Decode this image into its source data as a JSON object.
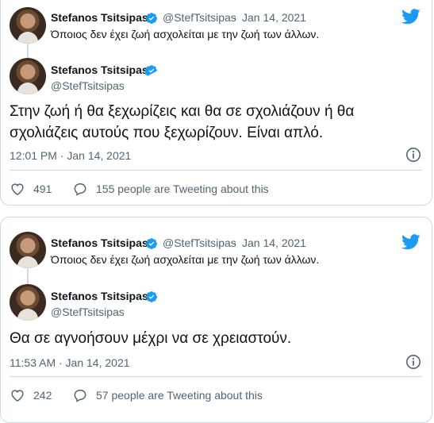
{
  "tweets": [
    {
      "quoted": {
        "name": "Stefanos Tsitsipas",
        "handle": "@StefTsitsipas",
        "sep": "·",
        "date": "Jan 14, 2021",
        "text": "Όποιος δεν έχει ζωή ασχολείται με την ζωή των άλλων."
      },
      "reply": {
        "name": "Stefanos Tsitsipas",
        "handle": "@StefTsitsipas",
        "text": "Στην ζωή ή θα ξεχωρίζεις και θα σε σχολιάζουν ή θα σχολιάζεις αυτούς που ξεχωρίζουν. Είναι απλό.",
        "timestamp": "12:01 PM · Jan 14, 2021",
        "likes": "491",
        "tweeting": "155 people are Tweeting about this"
      }
    },
    {
      "quoted": {
        "name": "Stefanos Tsitsipas",
        "handle": "@StefTsitsipas",
        "sep": "·",
        "date": "Jan 14, 2021",
        "text": "Όποιος δεν έχει ζωή ασχολείται με την ζωή των άλλων."
      },
      "reply": {
        "name": "Stefanos Tsitsipas",
        "handle": "@StefTsitsipas",
        "text": "Θα σε αγνοήσουν μέχρι να σε χρειαστούν.",
        "timestamp": "11:53 AM · Jan 14, 2021",
        "likes": "242",
        "tweeting": "57 people are Tweeting about this"
      }
    }
  ],
  "icons": {
    "brand": "twitter-bird-icon",
    "verified": "verified-badge-icon",
    "info": "info-icon",
    "like": "heart-icon",
    "reply": "speech-bubble-icon"
  },
  "colors": {
    "twitter_blue": "#1d9bf0",
    "text": "#0f1419",
    "muted": "#536471",
    "border": "#cfd9de"
  }
}
